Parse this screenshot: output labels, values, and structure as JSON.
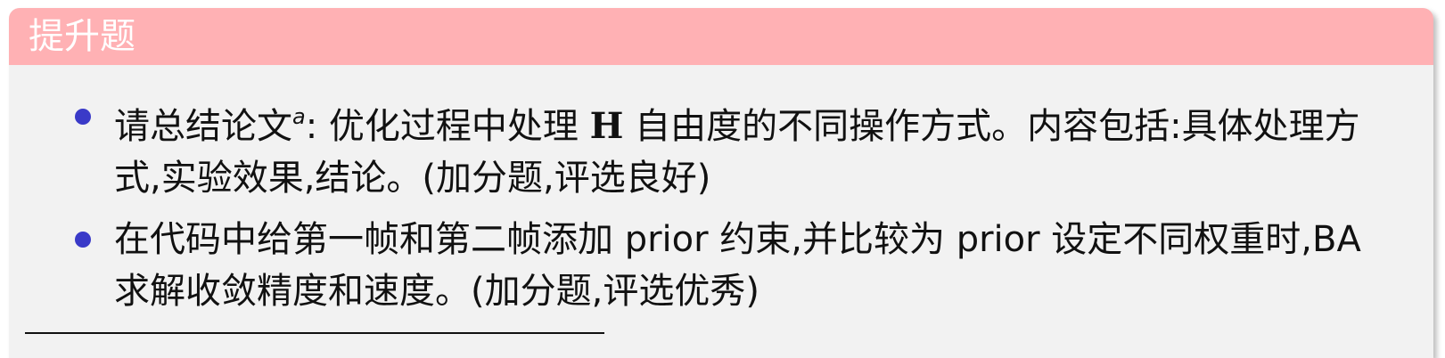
{
  "block": {
    "title": "提升题"
  },
  "items": [
    {
      "part1": "请总结论文",
      "footnote_mark": "a",
      "part2": ": 优化过程中处理 ",
      "bold": "H",
      "part3": " 自由度的不同操作方式。内容包括:具体处理方式,实验效果,结论。(加分题,评选良好)"
    },
    {
      "text": "在代码中给第一帧和第二帧添加 prior 约束,并比较为 prior 设定不同权重时,BA 求解收敛精度和速度。(加分题,评选优秀)"
    }
  ],
  "colors": {
    "header_bg": "#ffb1b4",
    "body_bg": "#f2f2f2",
    "bullet": "#3a3ac8",
    "title_text": "#ffffff"
  }
}
